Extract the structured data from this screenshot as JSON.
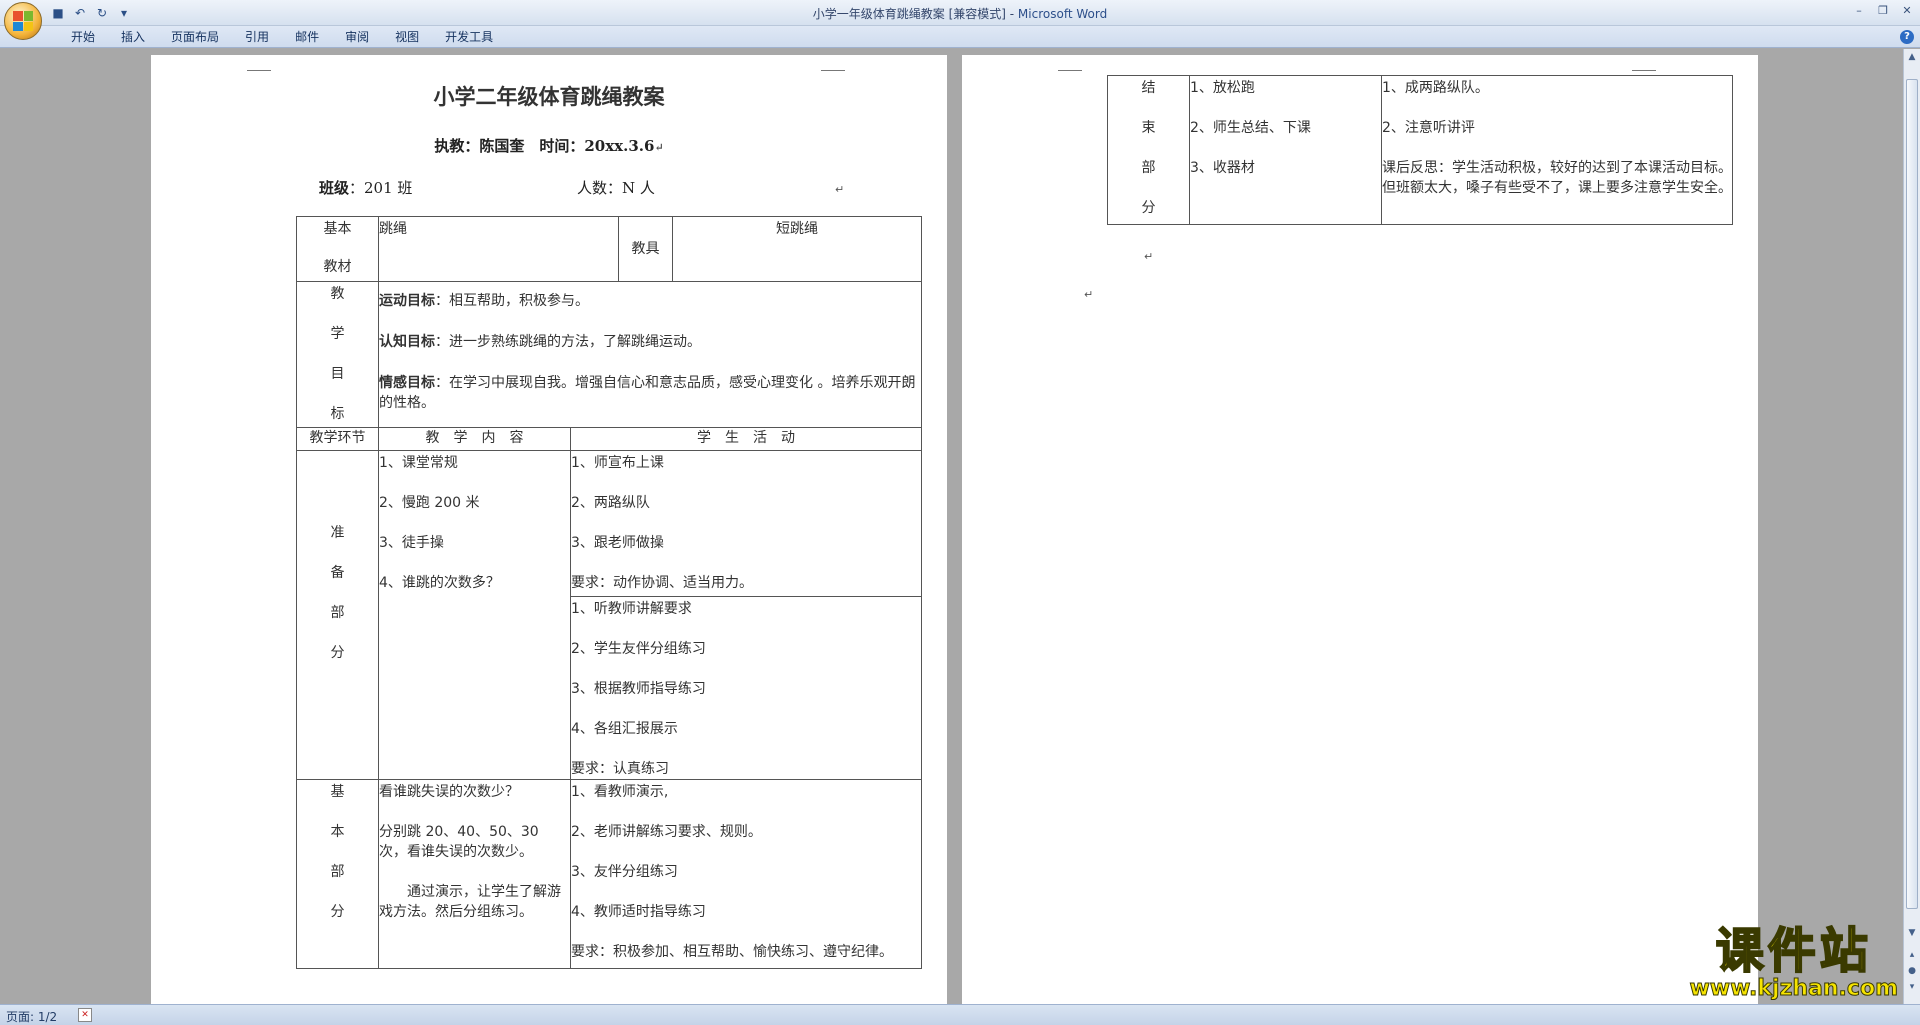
{
  "window": {
    "title": "小学一年级体育跳绳教案 [兼容模式] - ",
    "app_name": "Microsoft Word"
  },
  "ribbon": {
    "tabs": [
      "开始",
      "插入",
      "页面布局",
      "引用",
      "邮件",
      "审阅",
      "视图",
      "开发工具"
    ]
  },
  "doc": {
    "title": "小学二年级体育跳绳教案",
    "teacher_line": "执教：陈国奎　时间：20xx.3.6",
    "class_label": "班级",
    "class_value": "：201 班",
    "count_text": "人数：N 人",
    "basic_material_label": [
      "基本",
      "教材"
    ],
    "material": "跳绳",
    "equipment_label": "教具",
    "equipment": "短跳绳",
    "goals_label": [
      "教",
      "学",
      "目",
      "标"
    ],
    "goal1_head": "运动目标",
    "goal1_text": "：相互帮助，积极参与。",
    "goal2_head": "认知目标",
    "goal2_text": "：进一步熟练跳绳的方法，了解跳绳运动。",
    "goal3_head": "情感目标",
    "goal3_text": "：在学习中展现自我。增强自信心和意志品质，感受心理变化 。培养乐观开朗的性格。",
    "header_stage": "教学环节",
    "header_content": "教　学　内　容",
    "header_activity": "学　生　活　动",
    "prep_label": [
      "准",
      "备",
      "部",
      "分"
    ],
    "prep_content": [
      "1、课堂常规",
      "2、慢跑 200 米",
      "3、徒手操",
      "4、谁跳的次数多？"
    ],
    "prep_activity_a": [
      "1、师宣布上课",
      "2、两路纵队",
      "3、跟老师做操",
      "要求：动作协调、适当用力。"
    ],
    "prep_activity_b": [
      "1、听教师讲解要求",
      "2、学生友伴分组练习",
      "3、根据教师指导练习",
      "4、各组汇报展示",
      "要求：认真练习"
    ],
    "basic_label": [
      "基",
      "本",
      "部",
      "",
      "分"
    ],
    "basic_content": [
      "看谁跳失误的次数少？",
      "分别跳 20、40、50、30 次，看谁失误的次数少。",
      "　　通过演示，让学生了解游戏方法。然后分组练习。"
    ],
    "basic_activity": [
      "1、看教师演示,",
      "2、老师讲解练习要求、规则。",
      "3、友伴分组练习",
      "4、教师适时指导练习",
      "要求：积极参加、相互帮助、愉快练习、遵守纪律。"
    ],
    "end_label": [
      "结",
      "束",
      "部",
      "分"
    ],
    "end_content": [
      "1、放松跑",
      "2、师生总结、下课",
      "3、收器材"
    ],
    "end_activity": [
      "1、成两路纵队。",
      "2、注意听讲评",
      "课后反思：学生活动积极，较好的达到了本课活动目标。但班额太大，嗓子有些受不了，课上要多注意学生安全。"
    ]
  },
  "status": {
    "page": "页面: 1/2"
  },
  "watermark": {
    "big": "课件站",
    "url": "www.kjzhan.com"
  },
  "colors": {
    "ribbon": "#dfe8f5",
    "workspace": "#a8a8a8",
    "watermark": "#f6e400"
  }
}
